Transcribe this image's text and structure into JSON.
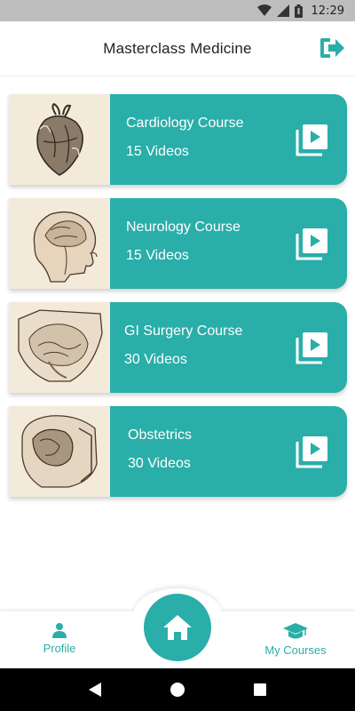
{
  "status_bar": {
    "time": "12:29"
  },
  "header": {
    "title": "Masterclass Medicine"
  },
  "courses": [
    {
      "title": "Cardiology Course",
      "count": "15 Videos",
      "thumb": "heart-illustration"
    },
    {
      "title": "Neurology Course",
      "count": "15 Videos",
      "thumb": "brain-head-illustration"
    },
    {
      "title": "GI Surgery Course",
      "count": "30 Videos",
      "thumb": "abdomen-illustration"
    },
    {
      "title": "Obstetrics",
      "count": "30 Videos",
      "thumb": "pelvis-illustration"
    }
  ],
  "bottom_nav": {
    "profile_label": "Profile",
    "courses_label": "My Courses"
  },
  "colors": {
    "accent": "#29aea9",
    "thumb_bg": "#f3ead9"
  }
}
